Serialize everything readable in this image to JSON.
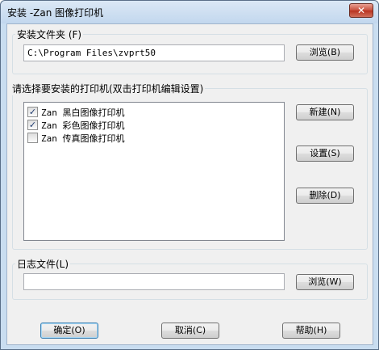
{
  "window": {
    "title": "安装 -Zan 图像打印机",
    "close_glyph": "✕"
  },
  "install_folder": {
    "label": "安装文件夹 (F)",
    "path": "C:\\Program Files\\zvprt50",
    "browse_label": "浏览(B)"
  },
  "printers": {
    "label": "请选择要安装的打印机(双击打印机编辑设置)",
    "items": [
      {
        "label": "Zan 黑白图像打印机",
        "checked": true
      },
      {
        "label": "Zan 彩色图像打印机",
        "checked": true
      },
      {
        "label": "Zan 传真图像打印机",
        "checked": false
      }
    ],
    "new_label": "新建(N)",
    "settings_label": "设置(S)",
    "delete_label": "删除(D)"
  },
  "log_file": {
    "label": "日志文件(L)",
    "path": "",
    "browse_label": "浏览(W)"
  },
  "footer": {
    "ok_label": "确定(O)",
    "cancel_label": "取消(C)",
    "help_label": "帮助(H)"
  }
}
